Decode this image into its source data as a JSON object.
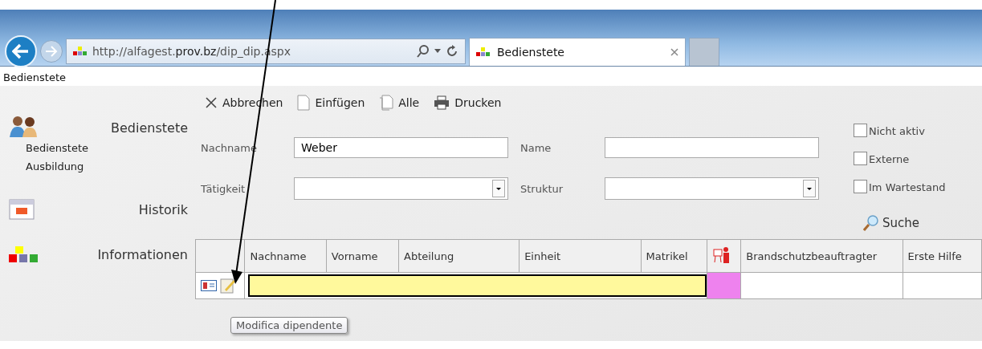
{
  "browser": {
    "url": "http://alfagest.**prov.bz**/dip_dip.aspx",
    "tab": {
      "title": "Bedienstete",
      "selected": true
    }
  },
  "page_title": "Bedienstete",
  "sidebar": [
    {
      "kind": "people",
      "title": "Bedienstete",
      "items": [
        "Bedienstete",
        "Ausbildung"
      ]
    },
    {
      "kind": "calendar",
      "title": "Historik"
    },
    {
      "kind": "blocks",
      "title": "Informationen"
    }
  ],
  "toolbar": [
    {
      "kind": "cancel",
      "label": "Abbrechen"
    },
    {
      "kind": "new",
      "label": "Einfügen"
    },
    {
      "kind": "copy",
      "label": "Alle"
    },
    {
      "kind": "print",
      "label": "Drucken"
    }
  ],
  "form": {
    "rows": [
      [
        {
          "label": "Nachname",
          "kind": "input",
          "value": "Weber"
        },
        {
          "label": "Name",
          "kind": "input"
        }
      ],
      [
        {
          "label": "Tätigkeit",
          "kind": "select"
        },
        {
          "label": "Struktur",
          "kind": "select"
        }
      ]
    ],
    "checkboxes": [
      {
        "label": "Nicht aktiv",
        "checked": false
      },
      {
        "label": "Externe",
        "checked": false
      },
      {
        "label": "Im Wartestand",
        "checked": false
      }
    ],
    "search": "Suche"
  },
  "table": {
    "columns": [
      {
        "kind": "actions"
      },
      {
        "kind": "text",
        "label": "Nachname"
      },
      {
        "kind": "text",
        "label": "Vorname"
      },
      {
        "kind": "text",
        "label": "Abteilung"
      },
      {
        "kind": "text",
        "label": "Einheit"
      },
      {
        "kind": "text",
        "label": "Matrikel"
      },
      {
        "kind": "icon"
      },
      {
        "kind": "text",
        "label": "Brandschutzbeauftragter"
      },
      {
        "kind": "text",
        "label": "Erste Hilfe"
      }
    ],
    "rows": [
      {
        "redacted": true,
        "color": "#ee82ee"
      }
    ]
  },
  "tooltip": "Modifica dipendente"
}
